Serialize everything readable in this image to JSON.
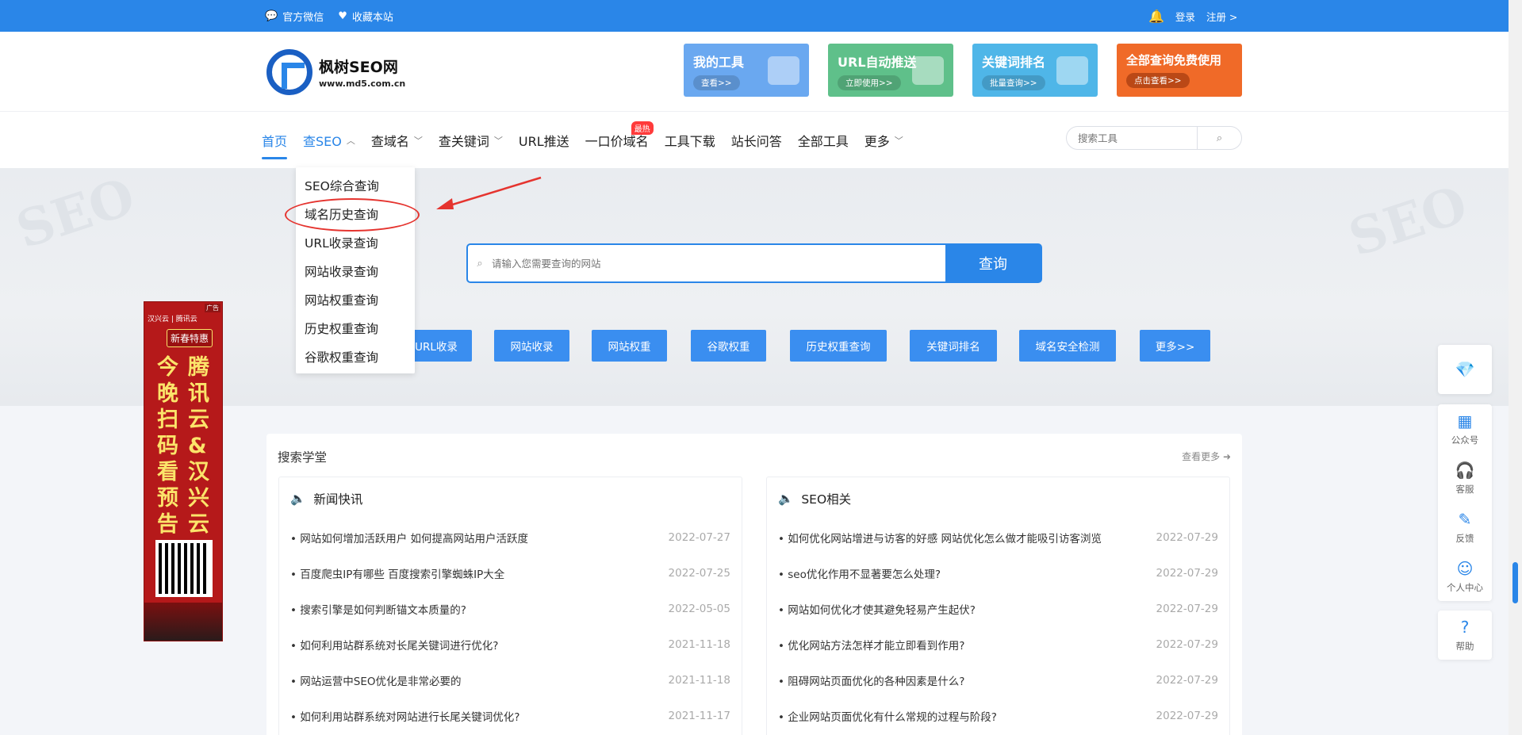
{
  "topbar": {
    "wechat": "官方微信",
    "favorite": "收藏本站",
    "login": "登录",
    "register": "注册 >"
  },
  "logo": {
    "name": "枫树SEO网",
    "url": "www.md5.com.cn"
  },
  "banners": [
    {
      "title": "我的工具",
      "sub": "查看>>",
      "color": "#6aa8f0"
    },
    {
      "title": "URL自动推送",
      "sub": "立即使用>>",
      "color": "#5fc08a"
    },
    {
      "title": "关键词排名",
      "sub": "批量查询>>",
      "color": "#4fb6e8"
    },
    {
      "title": "全部查询免费使用",
      "sub": "点击查看>>",
      "color": "#f06a28"
    }
  ],
  "nav": {
    "items": [
      {
        "label": "首页"
      },
      {
        "label": "查SEO"
      },
      {
        "label": "查域名"
      },
      {
        "label": "查关键词"
      },
      {
        "label": "URL推送"
      },
      {
        "label": "一口价域名",
        "badge": "最热"
      },
      {
        "label": "工具下载"
      },
      {
        "label": "站长问答"
      },
      {
        "label": "全部工具"
      },
      {
        "label": "更多"
      }
    ],
    "search_placeholder": "搜索工具"
  },
  "dropdown": {
    "items": [
      "SEO综合查询",
      "域名历史查询",
      "URL收录查询",
      "网站收录查询",
      "网站权重查询",
      "历史权重查询",
      "谷歌权重查询"
    ]
  },
  "hero": {
    "search_placeholder": "请输入您需要查询的网站",
    "search_button": "查询",
    "quick": [
      "URL收录",
      "网站收录",
      "网站权重",
      "谷歌权重",
      "历史权重查询",
      "关键词排名",
      "域名安全检测",
      "更多>>"
    ]
  },
  "ad": {
    "tag": "广告",
    "brand": "汉兴云 | 腾讯云",
    "pill": "新春特惠",
    "col1": [
      "今",
      "晚",
      "扫",
      "码",
      "看",
      "预",
      "告"
    ],
    "col2": [
      "腾",
      "讯",
      "云",
      "&",
      "汉",
      "兴",
      "云"
    ]
  },
  "content": {
    "title": "搜索学堂",
    "more": "查看更多",
    "news": {
      "title": "新闻快讯",
      "rows": [
        {
          "title": "网站如何增加活跃用户 如何提高网站用户活跃度",
          "date": "2022-07-27"
        },
        {
          "title": "百度爬虫IP有哪些 百度搜索引擎蜘蛛IP大全",
          "date": "2022-07-25"
        },
        {
          "title": "搜索引擎是如何判断锚文本质量的?",
          "date": "2022-05-05"
        },
        {
          "title": "如何利用站群系统对长尾关键词进行优化?",
          "date": "2021-11-18"
        },
        {
          "title": "网站运营中SEO优化是非常必要的",
          "date": "2021-11-18"
        },
        {
          "title": "如何利用站群系统对网站进行长尾关键词优化?",
          "date": "2021-11-17"
        }
      ]
    },
    "seo": {
      "title": "SEO相关",
      "rows": [
        {
          "title": "如何优化网站增进与访客的好感 网站优化怎么做才能吸引访客浏览",
          "date": "2022-07-29"
        },
        {
          "title": "seo优化作用不显著要怎么处理?",
          "date": "2022-07-29"
        },
        {
          "title": "网站如何优化才使其避免轻易产生起伏?",
          "date": "2022-07-29"
        },
        {
          "title": "优化网站方法怎样才能立即看到作用?",
          "date": "2022-07-29"
        },
        {
          "title": "阻碍网站页面优化的各种因素是什么?",
          "date": "2022-07-29"
        },
        {
          "title": "企业网站页面优化有什么常规的过程与阶段?",
          "date": "2022-07-29"
        }
      ]
    }
  },
  "float": {
    "items": [
      "公众号",
      "客服",
      "反馈",
      "个人中心"
    ],
    "help": "帮助"
  },
  "colors": {
    "primary": "#2a86e8",
    "accent_red": "#e5342f"
  }
}
